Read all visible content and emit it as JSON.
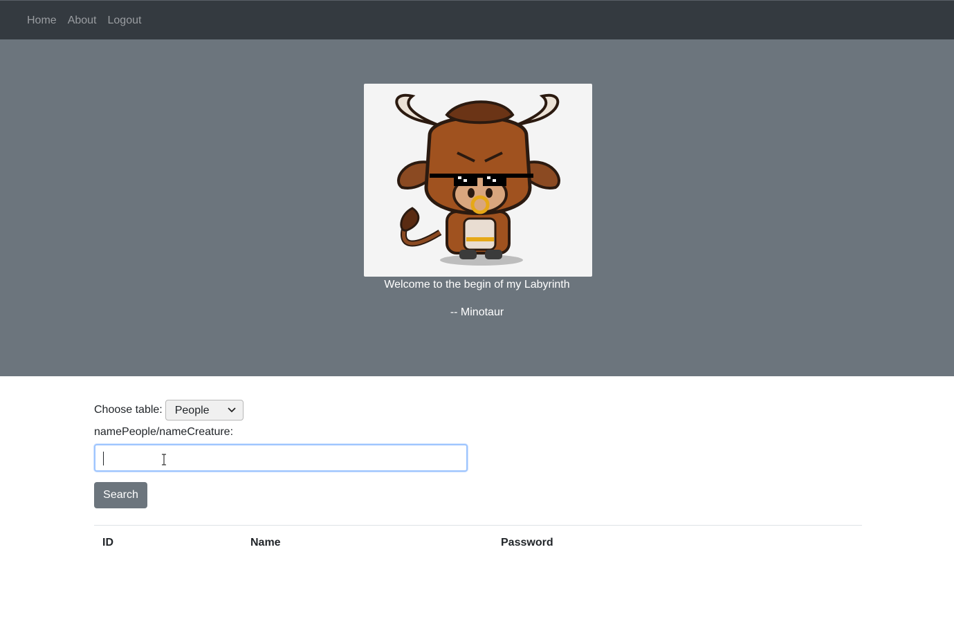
{
  "nav": {
    "items": [
      {
        "label": "Home"
      },
      {
        "label": "About"
      },
      {
        "label": "Logout"
      }
    ]
  },
  "hero": {
    "image_alt": "minotaur-mascot",
    "caption_line1": "Welcome to the begin of my Labyrinth",
    "caption_line2": "-- Minotaur"
  },
  "form": {
    "choose_label": "Choose table:",
    "select_value": "People",
    "field_label": "namePeople/nameCreature:",
    "input_value": "",
    "search_label": "Search"
  },
  "table": {
    "columns": [
      "ID",
      "Name",
      "Password"
    ]
  },
  "colors": {
    "navbar": "#343a40",
    "hero_bg": "#6c757d",
    "button": "#6c757d",
    "focus_border": "#9ec5fe"
  }
}
